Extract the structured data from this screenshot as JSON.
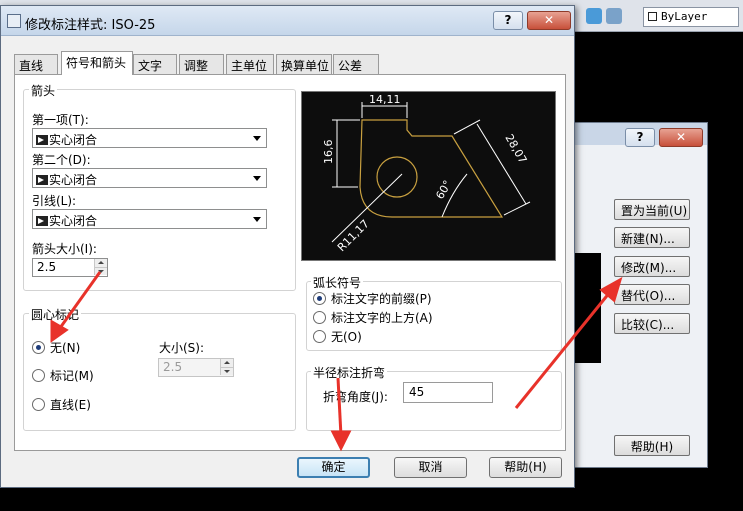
{
  "background": {
    "layer_label": "ByLayer",
    "manager_dialog": {
      "help_glyph": "?",
      "close_glyph": "✕",
      "buttons": [
        "置为当前(U)",
        "新建(N)...",
        "修改(M)...",
        "替代(O)...",
        "比较(C)..."
      ],
      "help_button": "帮助(H)"
    }
  },
  "dialog": {
    "title": "修改标注样式: ISO-25",
    "help_glyph": "?",
    "close_glyph": "✕",
    "tabs": [
      "直线",
      "符号和箭头",
      "文字",
      "调整",
      "主单位",
      "换算单位",
      "公差"
    ],
    "active_tab": 1,
    "arrowheads": {
      "title": "箭头",
      "first_label": "第一项(T):",
      "first_value": "实心闭合",
      "second_label": "第二个(D):",
      "second_value": "实心闭合",
      "leader_label": "引线(L):",
      "leader_value": "实心闭合",
      "size_label": "箭头大小(I):",
      "size_value": "2.5"
    },
    "center_marks": {
      "title": "圆心标记",
      "options": [
        "无(N)",
        "标记(M)",
        "直线(E)"
      ],
      "selected": 0,
      "size_label": "大小(S):",
      "size_value": "2.5"
    },
    "preview": {
      "dim_top": "14,11",
      "dim_left": "16,6",
      "dim_diag": "28,07",
      "dim_angle": "60°",
      "dim_radius": "R11,17"
    },
    "arc_length": {
      "title": "弧长符号",
      "options": [
        "标注文字的前缀(P)",
        "标注文字的上方(A)",
        "无(O)"
      ],
      "selected": 0
    },
    "radius_jog": {
      "title": "半径标注折弯",
      "angle_label": "折弯角度(J):",
      "angle_value": "45"
    },
    "buttons": {
      "ok": "确定",
      "cancel": "取消",
      "help": "帮助(H)"
    }
  },
  "colors": {
    "annotation_red": "#e8322a",
    "preview_yellow": "#c8a040"
  }
}
